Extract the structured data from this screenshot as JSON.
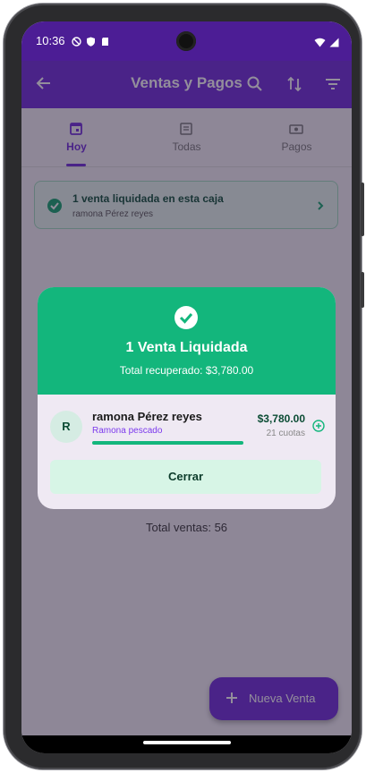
{
  "status_bar": {
    "time": "10:36"
  },
  "app_bar": {
    "title": "Ventas y Pagos"
  },
  "tabs": [
    {
      "label": "Hoy",
      "icon": "calendar-icon",
      "active": true
    },
    {
      "label": "Todas",
      "icon": "list-icon",
      "active": false
    },
    {
      "label": "Pagos",
      "icon": "cash-icon",
      "active": false
    }
  ],
  "banner": {
    "title": "1 venta liquidada en esta caja",
    "subtitle": "ramona  Pérez reyes"
  },
  "summary": {
    "total_ventas": "Total ventas: 56"
  },
  "fab": {
    "label": "Nueva Venta"
  },
  "dialog": {
    "title": "1 Venta Liquidada",
    "subtitle": "Total recuperado: $3,780.00",
    "item": {
      "avatar": "R",
      "name": "ramona  Pérez reyes",
      "product": "Ramona pescado",
      "amount": "$3,780.00",
      "cuotas": "21 cuotas",
      "progress": 1.0
    },
    "close_label": "Cerrar"
  },
  "colors": {
    "primary": "#6d28d9",
    "status_bar": "#4c1d95",
    "success": "#13b67c",
    "success_dark": "#0b4c34"
  }
}
